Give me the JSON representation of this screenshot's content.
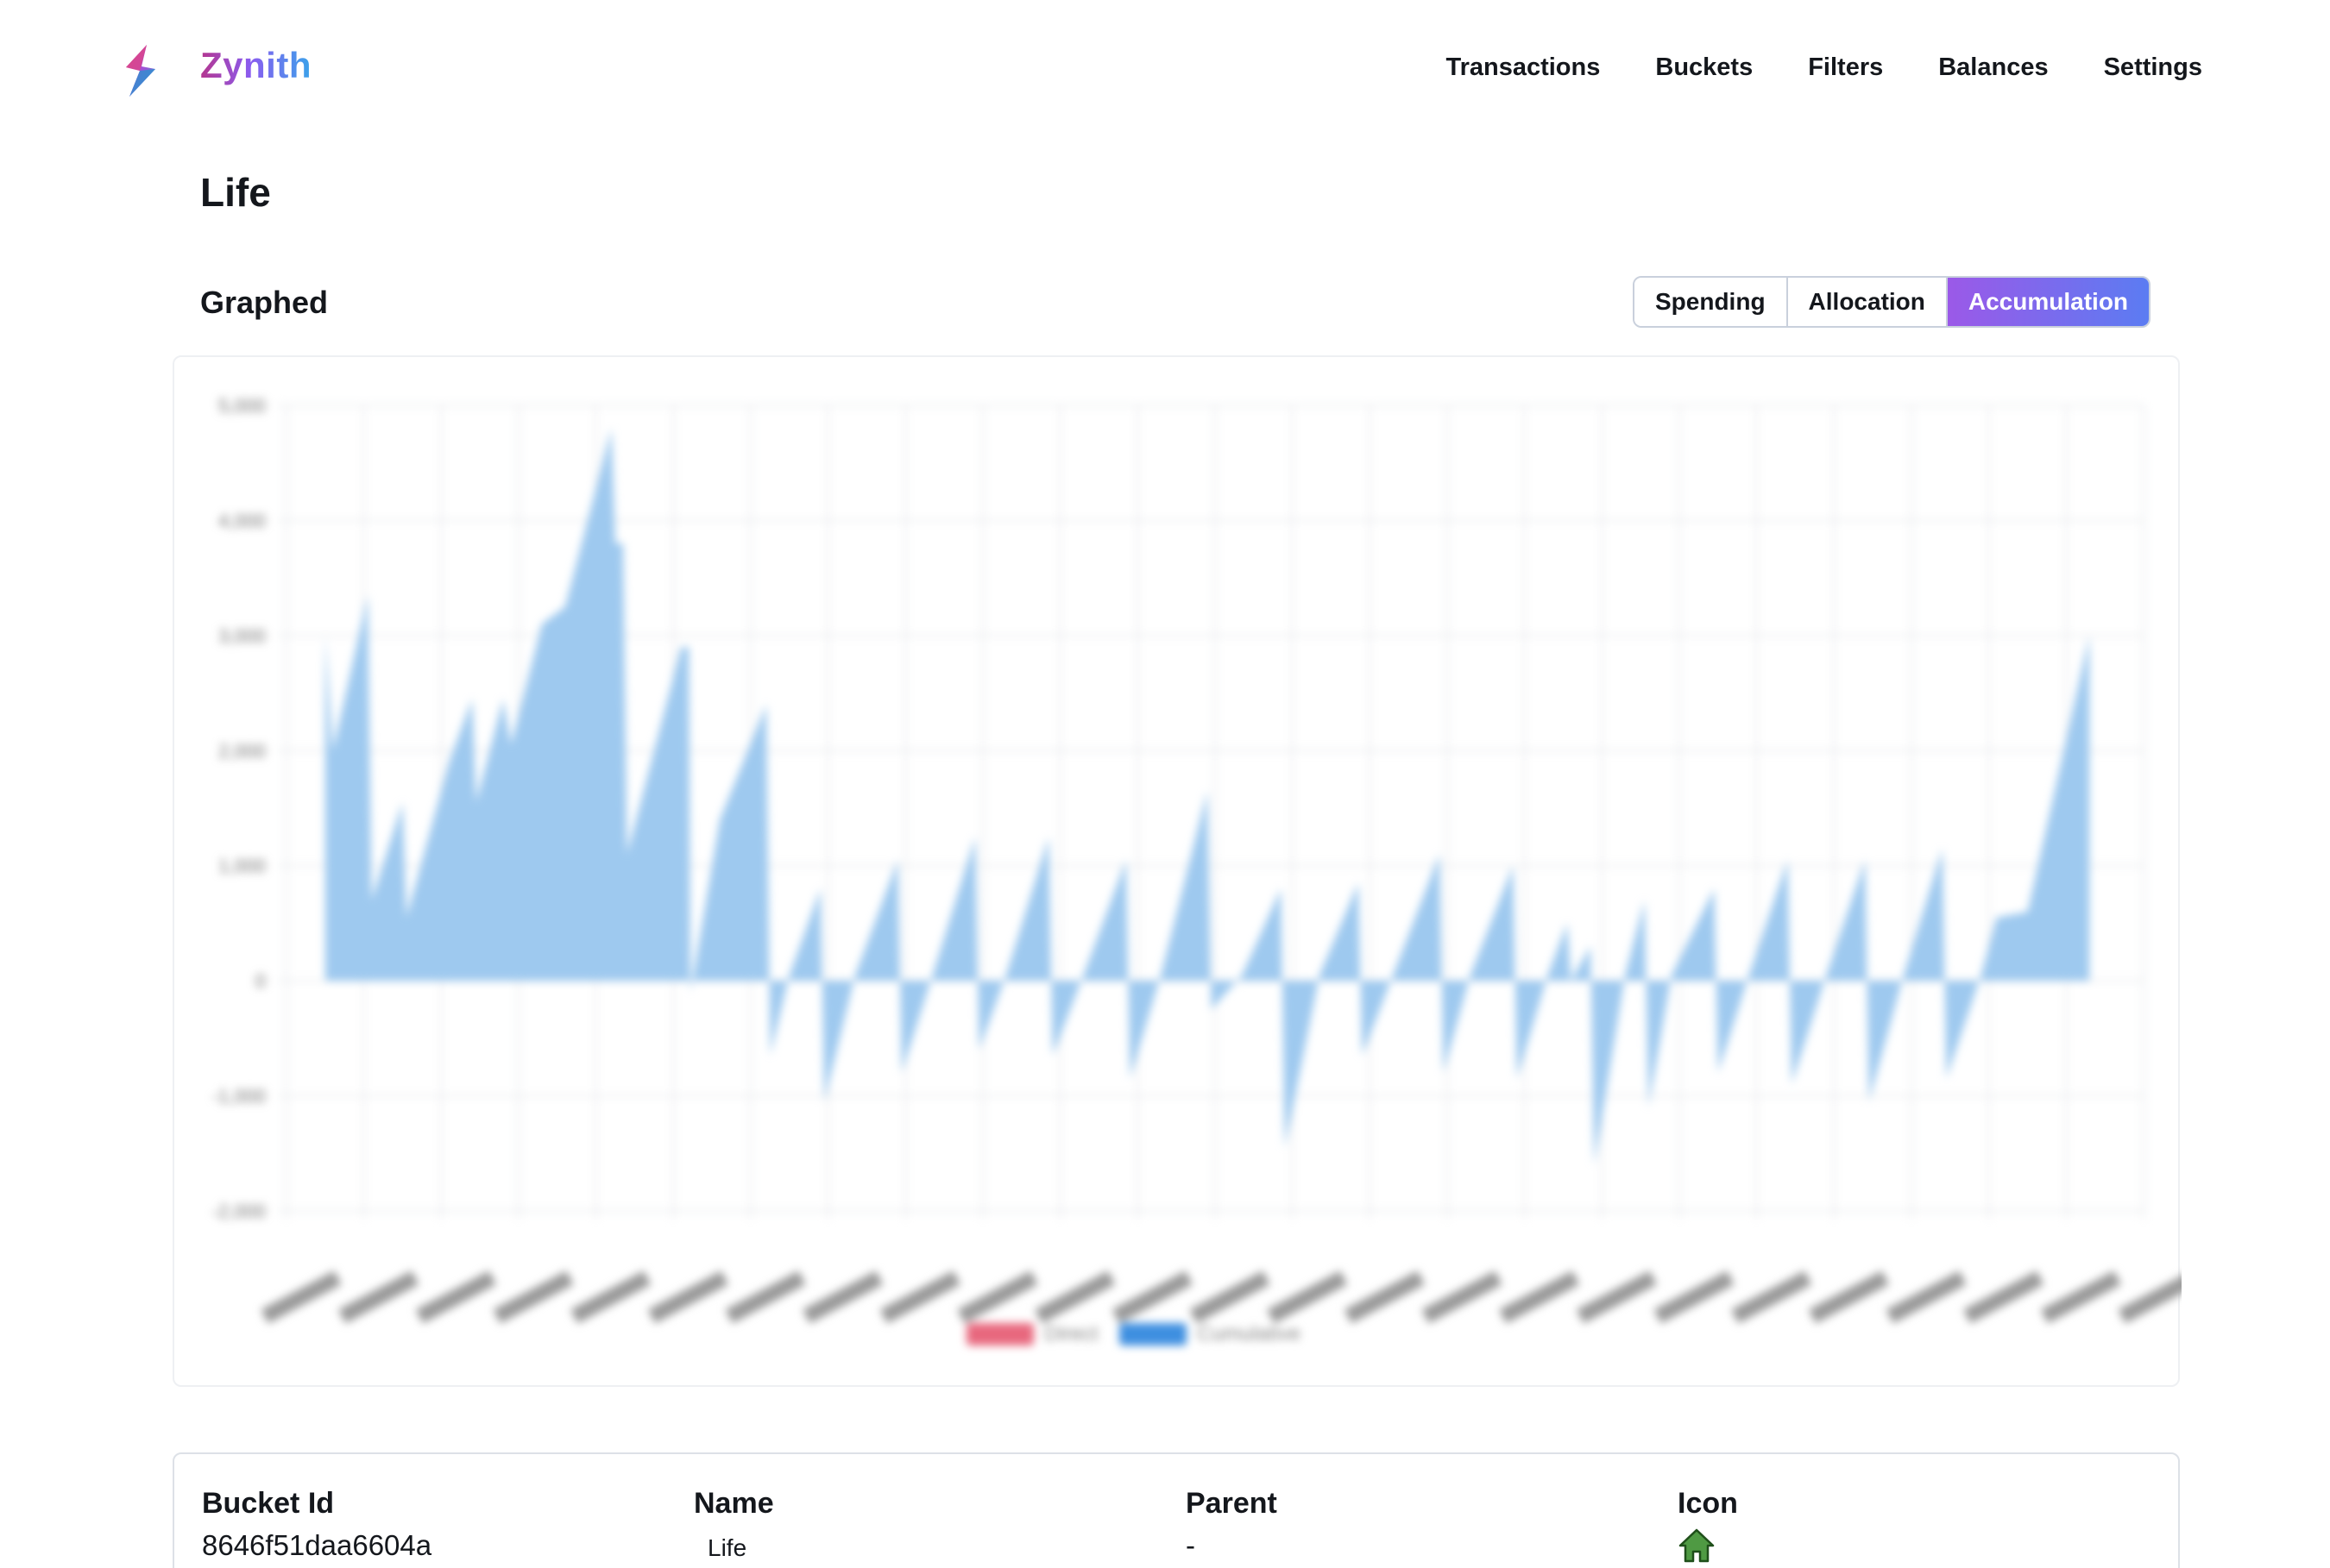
{
  "app": {
    "brand": "Zynith"
  },
  "nav": [
    "Transactions",
    "Buckets",
    "Filters",
    "Balances",
    "Settings"
  ],
  "page": {
    "title": "Life"
  },
  "graph": {
    "section_title": "Graphed",
    "views": [
      "Spending",
      "Allocation",
      "Accumulation"
    ],
    "active_view": "Accumulation"
  },
  "colors": {
    "accent_purple": "#9b59e8",
    "accent_blue": "#5b7cf2",
    "series_fill": "#9ec9ef",
    "series_stroke": "#3e8fe0",
    "direct": "#e8687e"
  },
  "chart_data": {
    "type": "area",
    "xlabel": "",
    "ylabel": "",
    "yticks": [
      "5,000",
      "4,000",
      "3,000",
      "2,000",
      "1,000",
      "0",
      "-1,000",
      "-2,000"
    ],
    "xticks": [
      "",
      "",
      "",
      "",
      "",
      "",
      "",
      "",
      "",
      "",
      "",
      "",
      "",
      "",
      "",
      "",
      "",
      "",
      "",
      "",
      "",
      "",
      "",
      "",
      ""
    ],
    "ylim": [
      -2000,
      5000
    ],
    "legend": [
      "Direct",
      "Cumulative"
    ],
    "legend_position": "bottom",
    "grid": true,
    "series": [
      {
        "name": "Cumulative",
        "values": [
          {
            "x": 0.5,
            "y": 3000
          },
          {
            "x": 0.6,
            "y": 2000
          },
          {
            "x": 1.05,
            "y": 3350
          },
          {
            "x": 1.1,
            "y": 700
          },
          {
            "x": 1.5,
            "y": 1550
          },
          {
            "x": 1.55,
            "y": 550
          },
          {
            "x": 2.1,
            "y": 1900
          },
          {
            "x": 2.4,
            "y": 2450
          },
          {
            "x": 2.45,
            "y": 1550
          },
          {
            "x": 2.8,
            "y": 2450
          },
          {
            "x": 2.9,
            "y": 2050
          },
          {
            "x": 3.3,
            "y": 3100
          },
          {
            "x": 3.6,
            "y": 3250
          },
          {
            "x": 4.2,
            "y": 4800
          },
          {
            "x": 4.25,
            "y": 3800
          },
          {
            "x": 4.35,
            "y": 3800
          },
          {
            "x": 4.4,
            "y": 1100
          },
          {
            "x": 5.1,
            "y": 2900
          },
          {
            "x": 5.2,
            "y": 2900
          },
          {
            "x": 5.22,
            "y": -100
          },
          {
            "x": 5.6,
            "y": 1400
          },
          {
            "x": 6.2,
            "y": 2400
          },
          {
            "x": 6.25,
            "y": -650
          },
          {
            "x": 6.5,
            "y": 50
          },
          {
            "x": 6.9,
            "y": 800
          },
          {
            "x": 6.95,
            "y": -1050
          },
          {
            "x": 7.35,
            "y": 50
          },
          {
            "x": 7.9,
            "y": 1050
          },
          {
            "x": 7.95,
            "y": -800
          },
          {
            "x": 8.35,
            "y": 50
          },
          {
            "x": 8.9,
            "y": 1250
          },
          {
            "x": 8.95,
            "y": -600
          },
          {
            "x": 9.3,
            "y": 50
          },
          {
            "x": 9.85,
            "y": 1250
          },
          {
            "x": 9.9,
            "y": -650
          },
          {
            "x": 10.3,
            "y": 50
          },
          {
            "x": 10.85,
            "y": 1050
          },
          {
            "x": 10.9,
            "y": -850
          },
          {
            "x": 11.3,
            "y": 50
          },
          {
            "x": 11.9,
            "y": 1650
          },
          {
            "x": 11.95,
            "y": -250
          },
          {
            "x": 12.35,
            "y": 50
          },
          {
            "x": 12.85,
            "y": 800
          },
          {
            "x": 12.9,
            "y": -1450
          },
          {
            "x": 13.35,
            "y": 50
          },
          {
            "x": 13.85,
            "y": 850
          },
          {
            "x": 13.9,
            "y": -650
          },
          {
            "x": 14.3,
            "y": 50
          },
          {
            "x": 14.9,
            "y": 1100
          },
          {
            "x": 14.95,
            "y": -800
          },
          {
            "x": 15.3,
            "y": 50
          },
          {
            "x": 15.85,
            "y": 1000
          },
          {
            "x": 15.9,
            "y": -850
          },
          {
            "x": 16.3,
            "y": 50
          },
          {
            "x": 16.55,
            "y": 500
          },
          {
            "x": 16.6,
            "y": 0
          },
          {
            "x": 16.85,
            "y": 300
          },
          {
            "x": 16.9,
            "y": -1600
          },
          {
            "x": 17.3,
            "y": 50
          },
          {
            "x": 17.55,
            "y": 700
          },
          {
            "x": 17.6,
            "y": -1100
          },
          {
            "x": 17.9,
            "y": 50
          },
          {
            "x": 18.45,
            "y": 800
          },
          {
            "x": 18.5,
            "y": -800
          },
          {
            "x": 18.9,
            "y": 50
          },
          {
            "x": 19.4,
            "y": 1050
          },
          {
            "x": 19.45,
            "y": -900
          },
          {
            "x": 19.9,
            "y": 50
          },
          {
            "x": 20.4,
            "y": 1050
          },
          {
            "x": 20.45,
            "y": -1050
          },
          {
            "x": 20.9,
            "y": 50
          },
          {
            "x": 21.4,
            "y": 1150
          },
          {
            "x": 21.45,
            "y": -850
          },
          {
            "x": 21.9,
            "y": 50
          },
          {
            "x": 22.1,
            "y": 550
          },
          {
            "x": 22.5,
            "y": 600
          },
          {
            "x": 23.3,
            "y": 3000
          }
        ]
      }
    ]
  },
  "details": {
    "bucket_id_label": "Bucket Id",
    "bucket_id": "8646f51daa6604a",
    "name_label": "Name",
    "name": "Life",
    "parent_label": "Parent",
    "parent": "-",
    "icon_label": "Icon",
    "icon": "house-icon"
  }
}
